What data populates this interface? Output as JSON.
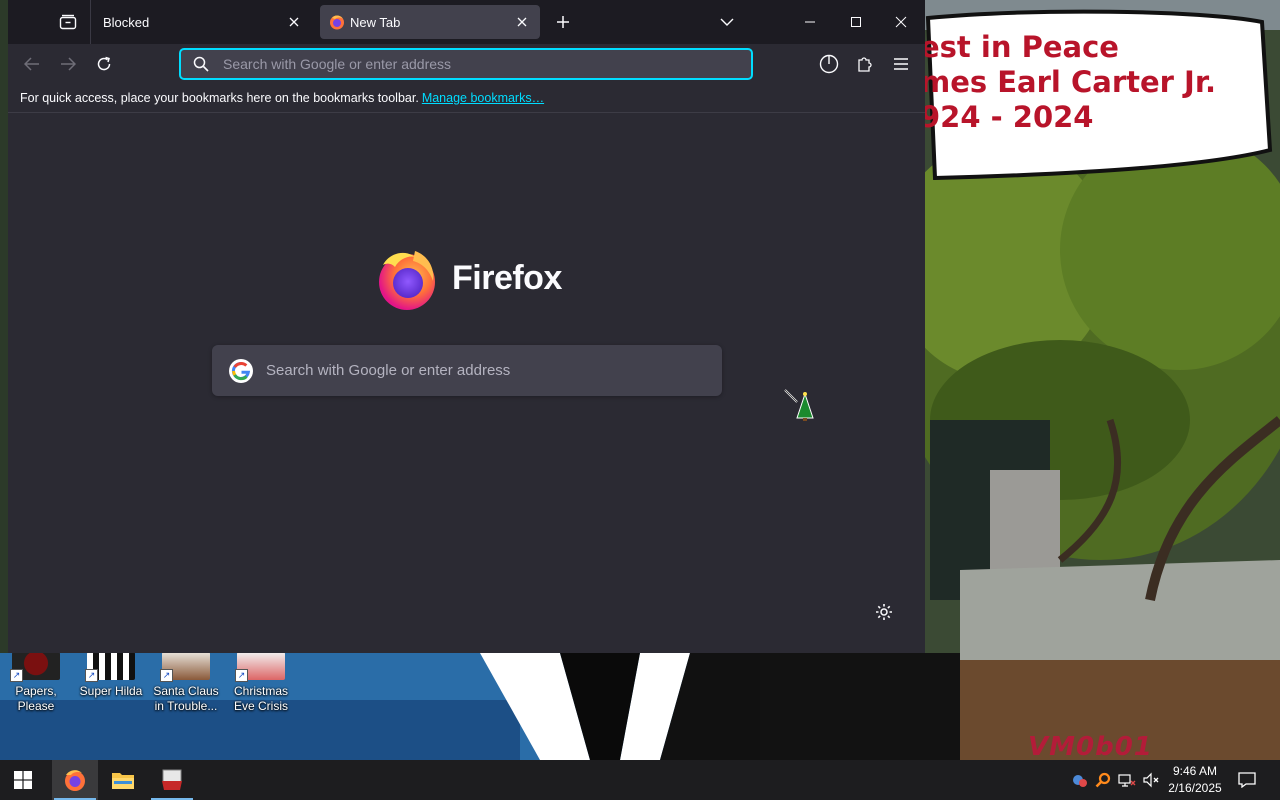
{
  "browser": {
    "tabs": [
      {
        "label": "Blocked"
      },
      {
        "label": "New Tab"
      }
    ],
    "urlbar": {
      "placeholder": "Search with Google or enter address"
    },
    "bookmarks_bar": {
      "message": "For quick access, place your bookmarks here on the bookmarks toolbar.",
      "link": "Manage bookmarks…"
    },
    "newtab": {
      "wordmark": "Firefox",
      "search_placeholder": "Search with Google or enter address"
    }
  },
  "wallpaper": {
    "sign_lines": [
      "est in Peace",
      "mes Earl Carter Jr.",
      "924 - 2024"
    ],
    "watermark": "VM0b01"
  },
  "desktop_icons": [
    {
      "label": "Papers, Please"
    },
    {
      "label": "Super Hilda"
    },
    {
      "label": "Santa Claus in Trouble..."
    },
    {
      "label": "Christmas Eve Crisis"
    }
  ],
  "taskbar": {
    "time": "9:46 AM",
    "date": "2/16/2025",
    "apps": [
      "start-icon",
      "firefox-icon",
      "file-explorer-icon",
      "game-app-icon"
    ]
  },
  "colors": {
    "accent": "#00ddff",
    "toolbar": "#2b2a33",
    "tabstrip": "#1c1b22",
    "selected_tab": "#42414d",
    "sign_text": "#b8142a"
  }
}
